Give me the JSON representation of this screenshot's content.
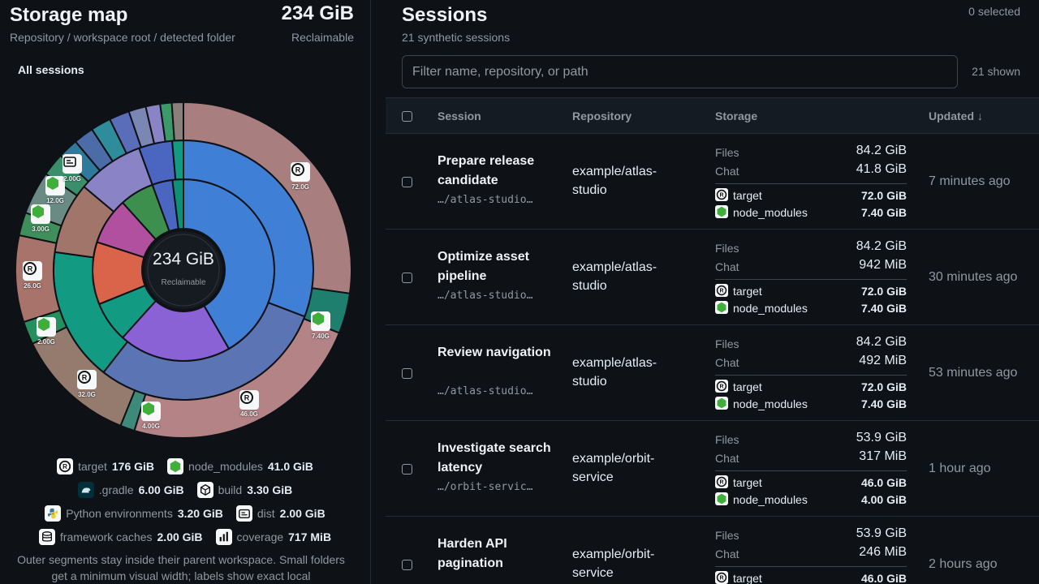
{
  "storage_map": {
    "title": "Storage map",
    "subtitle": "Repository / workspace root / detected folder",
    "total": "234 GiB",
    "total_label": "Reclaimable",
    "scope": "All sessions",
    "center_value": "234 GiB",
    "center_label": "Reclaimable",
    "segment_labels": [
      "72.0G",
      "7.40G",
      "46.0G",
      "4.00G",
      "32.0G",
      "2.00G",
      "26.0G",
      "3.00G",
      "12.0G",
      "2.00G"
    ],
    "legend": [
      {
        "icon": "rust-icon",
        "name": "target",
        "value": "176 GiB"
      },
      {
        "icon": "node-icon",
        "name": "node_modules",
        "value": "41.0 GiB"
      },
      {
        "icon": "gradle-icon",
        "name": ".gradle",
        "value": "6.00 GiB"
      },
      {
        "icon": "cube-icon",
        "name": "build",
        "value": "3.30 GiB"
      },
      {
        "icon": "python-icon",
        "name": "Python environments",
        "value": "3.20 GiB"
      },
      {
        "icon": "folder-icon",
        "name": "dist",
        "value": "2.00 GiB"
      },
      {
        "icon": "database-icon",
        "name": "framework caches",
        "value": "2.00 GiB"
      },
      {
        "icon": "bar-chart-icon",
        "name": "coverage",
        "value": "717 MiB"
      }
    ],
    "note": "Outer segments stay inside their parent workspace. Small folders get a minimum visual width; labels show exact local"
  },
  "sessions": {
    "title": "Sessions",
    "subtitle": "21 synthetic sessions",
    "selected": "0 selected",
    "filter_placeholder": "Filter name, repository, or path",
    "shown": "21 shown",
    "columns": {
      "session": "Session",
      "repository": "Repository",
      "storage": "Storage",
      "updated": "Updated ↓"
    },
    "rows": [
      {
        "title": "Prepare release candidate",
        "path": "…/atlas-studio…",
        "repo": "example/atlas-studio",
        "files": "84.2 GiB",
        "chat": "41.8 GiB",
        "f1_name": "target",
        "f1_val": "72.0 GiB",
        "f2_name": "node_modules",
        "f2_val": "7.40 GiB",
        "updated": "7 minutes ago"
      },
      {
        "title": "Optimize asset pipeline",
        "path": "…/atlas-studio…",
        "repo": "example/atlas-studio",
        "files": "84.2 GiB",
        "chat": "942 MiB",
        "f1_name": "target",
        "f1_val": "72.0 GiB",
        "f2_name": "node_modules",
        "f2_val": "7.40 GiB",
        "updated": "30 minutes ago"
      },
      {
        "title": "Review navigation",
        "path": "…/atlas-studio…",
        "repo": "example/atlas-studio",
        "files": "84.2 GiB",
        "chat": "492 MiB",
        "f1_name": "target",
        "f1_val": "72.0 GiB",
        "f2_name": "node_modules",
        "f2_val": "7.40 GiB",
        "updated": "53 minutes ago"
      },
      {
        "title": "Investigate search latency",
        "path": "…/orbit-servic…",
        "repo": "example/orbit-service",
        "files": "53.9 GiB",
        "chat": "317 MiB",
        "f1_name": "target",
        "f1_val": "46.0 GiB",
        "f2_name": "node_modules",
        "f2_val": "4.00 GiB",
        "updated": "1 hour ago"
      },
      {
        "title": "Harden API pagination",
        "path": "",
        "repo": "example/orbit-service",
        "files": "53.9 GiB",
        "chat": "246 MiB",
        "f1_name": "target",
        "f1_val": "46.0 GiB",
        "f2_name": "node_modules",
        "f2_val": "",
        "updated": "2 hours ago"
      }
    ],
    "storage_labels": {
      "files": "Files",
      "chat": "Chat"
    }
  },
  "colors": {
    "blue": "#3f7fd6",
    "purple": "#8a62d6",
    "teal": "#129a82",
    "orange": "#d9644a",
    "rose": "#a87f7e",
    "steel": "#5a74b4"
  }
}
